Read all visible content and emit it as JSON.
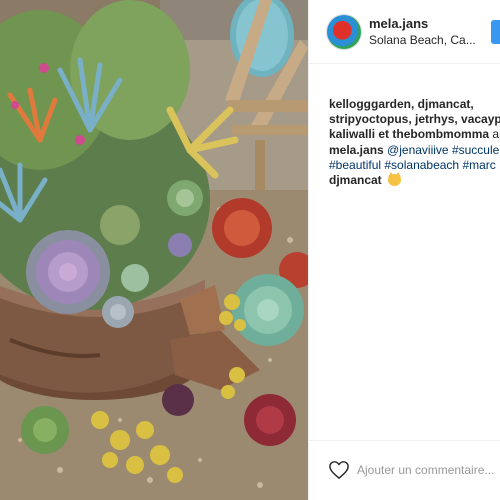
{
  "post": {
    "username": "mela.jans",
    "location": "Solana Beach, Ca...",
    "likes_names": "kellogggarden, djmancat, stripyoctopus, jetrhys, vacayph",
    "likes_tail_names": "kaliwalli et thebombmomma",
    "likes_tail_suffix": "aim"
  },
  "comments": [
    {
      "author": "mela.jans",
      "mention": "@jenaviiive",
      "tag_line1": "#succulen",
      "line2": "#beautiful #solanabeach #marc"
    },
    {
      "author": "djmancat",
      "emoji": "cat-face-icon"
    }
  ],
  "footer": {
    "add_comment_placeholder": "Ajouter un commentaire..."
  },
  "colors": {
    "accent": "#3897f0",
    "hashtag": "#003569",
    "border": "#efefef",
    "text": "#262626"
  },
  "icons": [
    "heart-icon",
    "cat-face-icon"
  ]
}
